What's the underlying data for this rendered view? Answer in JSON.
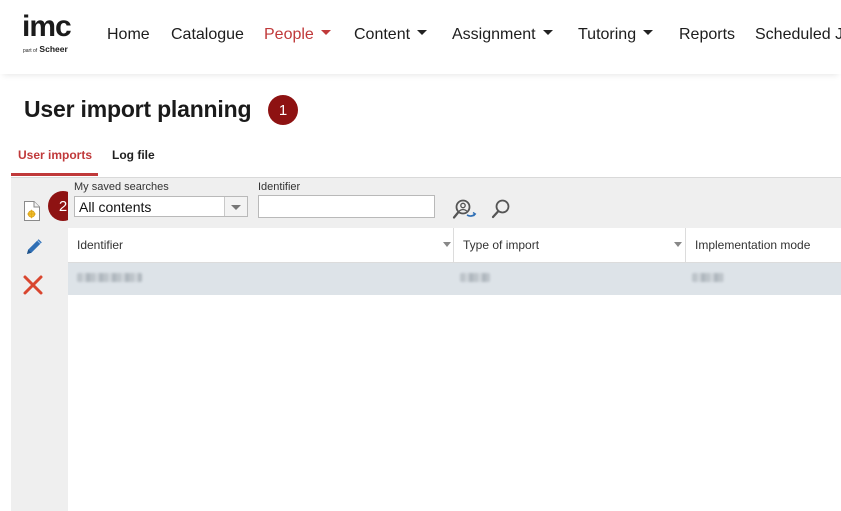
{
  "app": {
    "logo": {
      "main": "imc",
      "sub_prefix": "part of",
      "sub_brand": "Scheer"
    }
  },
  "nav": {
    "items": [
      {
        "label": "Home",
        "has_menu": false,
        "active": false
      },
      {
        "label": "Catalogue",
        "has_menu": false,
        "active": false
      },
      {
        "label": "People",
        "has_menu": true,
        "active": true
      },
      {
        "label": "Content",
        "has_menu": true,
        "active": false
      },
      {
        "label": "Assignment",
        "has_menu": true,
        "active": false
      },
      {
        "label": "Tutoring",
        "has_menu": true,
        "active": false
      },
      {
        "label": "Reports",
        "has_menu": false,
        "active": false
      },
      {
        "label": "Scheduled J",
        "has_menu": false,
        "active": false
      }
    ]
  },
  "page": {
    "title": "User import planning"
  },
  "markers": {
    "one": "1",
    "two": "2"
  },
  "tabs": [
    {
      "label": "User imports",
      "active": true
    },
    {
      "label": "Log file",
      "active": false
    }
  ],
  "toolbar": {
    "actions": [
      {
        "name": "new-document",
        "icon": "new-document-icon"
      },
      {
        "name": "edit",
        "icon": "pencil-icon"
      },
      {
        "name": "delete",
        "icon": "red-x-icon"
      }
    ]
  },
  "search": {
    "saved_searches_label": "My saved searches",
    "saved_searches_value": "All contents",
    "identifier_label": "Identifier",
    "identifier_value": "",
    "search_icon": "search-icon",
    "clear_icon": "user-search-icon"
  },
  "grid": {
    "columns": [
      {
        "label": "Identifier"
      },
      {
        "label": "Type of import"
      },
      {
        "label": "Implementation mode"
      }
    ],
    "rows": [
      {
        "identifier": "",
        "type": "",
        "mode": "",
        "obscured": true
      }
    ]
  },
  "colors": {
    "accent": "#c0393a",
    "marker": "#8e1212",
    "panel_bg": "#efefef",
    "selected_row": "#dde3e8",
    "edit_icon": "#2f6fb5",
    "delete_icon": "#d9462f"
  }
}
